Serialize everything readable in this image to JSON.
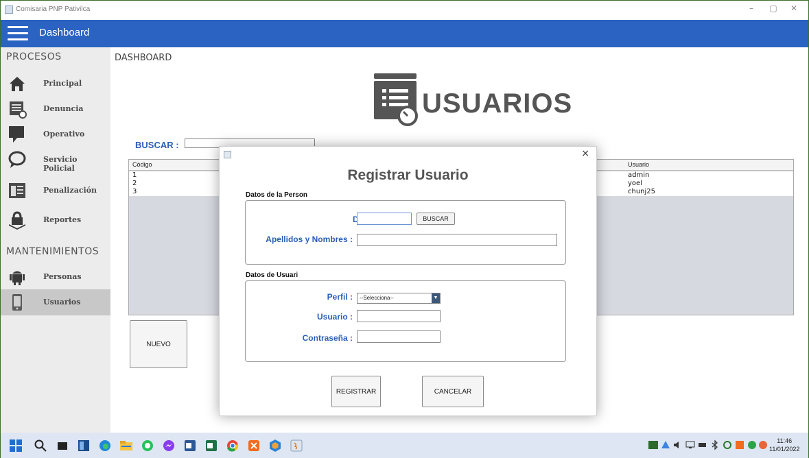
{
  "window": {
    "title": "Comisaria PNP Pativilca",
    "minimize": "–",
    "maximize": "▢",
    "close": "✕"
  },
  "header": {
    "title": "Dashboard"
  },
  "sidebar": {
    "procesos_title": "PROCESOS",
    "mantenimientos_title": "MANTENIMIENTOS",
    "items": [
      {
        "label": "Principal",
        "icon": "home-icon"
      },
      {
        "label": "Denuncia",
        "icon": "document-icon"
      },
      {
        "label": "Operativo",
        "icon": "chat-icon"
      },
      {
        "label": "Servicio Policial",
        "icon": "speech-bubble-icon"
      },
      {
        "label": "Penalización",
        "icon": "list-icon"
      },
      {
        "label": "Reportes",
        "icon": "reports-icon"
      },
      {
        "label": "Personas",
        "icon": "android-icon"
      },
      {
        "label": "Usuarios",
        "icon": "phone-icon"
      }
    ]
  },
  "main": {
    "section_label": "DASHBOARD",
    "hero_title": "USUARIOS",
    "search_label": "BUSCAR :",
    "table": {
      "headers": [
        "Código",
        "Usuario"
      ],
      "rows": [
        {
          "codigo": "1",
          "usuario": "admin"
        },
        {
          "codigo": "2",
          "usuario": "yoel"
        },
        {
          "codigo": "3",
          "usuario": "chunj25"
        }
      ]
    },
    "new_button": "NUEVO"
  },
  "modal": {
    "title": "Registrar Usuario",
    "close": "×",
    "person_section": "Datos de la Person",
    "dni_label": "DNI :",
    "search_button": "BUSCAR",
    "names_label": "Apellidos y Nombres :",
    "user_section": "Datos de Usuari",
    "perfil_label": "Perfil :",
    "perfil_selected": "--Selecciona--",
    "usuario_label": "Usuario :",
    "password_label": "Contraseña :",
    "register_button": "REGISTRAR",
    "cancel_button": "CANCELAR"
  },
  "taskbar": {
    "time": "11:46",
    "date": "11/01/2022"
  },
  "colors": {
    "accent": "#2a63c2",
    "label_blue": "#2b5fb8"
  }
}
